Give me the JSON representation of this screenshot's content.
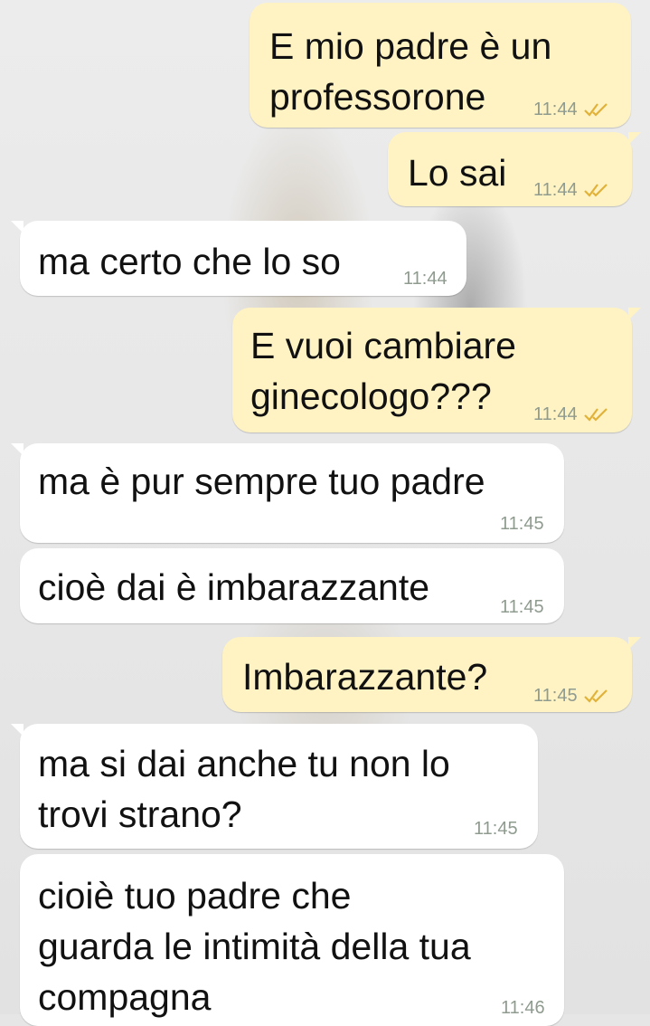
{
  "messages": [
    {
      "direction": "outgoing",
      "text": "E mio padre è un\nprofessorone",
      "time": "11:44",
      "read": true
    },
    {
      "direction": "outgoing",
      "text": "Lo sai",
      "time": "11:44",
      "read": true
    },
    {
      "direction": "incoming",
      "text": "ma certo che lo so",
      "time": "11:44"
    },
    {
      "direction": "outgoing",
      "text": "E vuoi cambiare\nginecologo???",
      "time": "11:44",
      "read": true
    },
    {
      "direction": "incoming",
      "text": "ma è pur sempre tuo padre",
      "time": "11:45"
    },
    {
      "direction": "incoming",
      "text": "cioè dai è imbarazzante",
      "time": "11:45"
    },
    {
      "direction": "outgoing",
      "text": "Imbarazzante?",
      "time": "11:45",
      "read": true
    },
    {
      "direction": "incoming",
      "text": "ma si dai anche tu non lo\ntrovi strano?",
      "time": "11:45"
    },
    {
      "direction": "incoming",
      "text": "cioiè tuo padre che\nguarda le intimità della tua\ncompagna",
      "time": "11:46"
    }
  ],
  "colors": {
    "outgoing_bubble": "#fff3c4",
    "incoming_bubble": "#ffffff",
    "read_ticks": "#e0b23a",
    "timestamp": "#8f9b8f"
  },
  "icons": {
    "read_receipt": "double-check-icon"
  }
}
